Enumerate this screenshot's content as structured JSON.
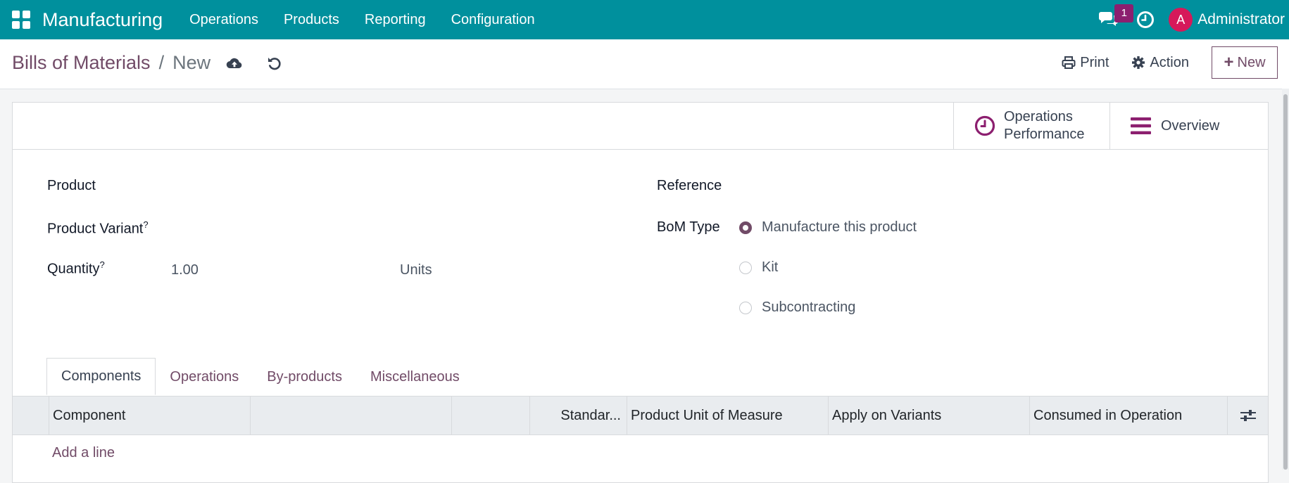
{
  "topbar": {
    "app_title": "Manufacturing",
    "menu": [
      "Operations",
      "Products",
      "Reporting",
      "Configuration"
    ],
    "message_count": "1",
    "avatar_letter": "A",
    "user_name": "Administrator",
    "color": "#00909d"
  },
  "control_panel": {
    "breadcrumb_parent": "Bills of Materials",
    "breadcrumb_separator": "/",
    "breadcrumb_current": "New",
    "print_label": "Print",
    "action_label": "Action",
    "new_label": "New"
  },
  "stat_buttons": {
    "operations_performance_line1": "Operations",
    "operations_performance_line2": "Performance",
    "overview": "Overview"
  },
  "form": {
    "product_label": "Product",
    "product_variant_label": "Product Variant",
    "quantity_label": "Quantity",
    "help_mark": "?",
    "quantity_value": "1.00",
    "uom_value": "Units",
    "reference_label": "Reference",
    "bom_type_label": "BoM Type",
    "bom_type_options": [
      "Manufacture this product",
      "Kit",
      "Subcontracting"
    ],
    "bom_type_selected": "Manufacture this product"
  },
  "tabs": [
    "Components",
    "Operations",
    "By-products",
    "Miscellaneous"
  ],
  "table": {
    "headers": [
      "Component",
      "",
      "",
      "Standar...",
      "Product Unit of Measure",
      "Apply on Variants",
      "Consumed in Operation"
    ],
    "add_line": "Add a line"
  },
  "accent_color": "#714b67"
}
